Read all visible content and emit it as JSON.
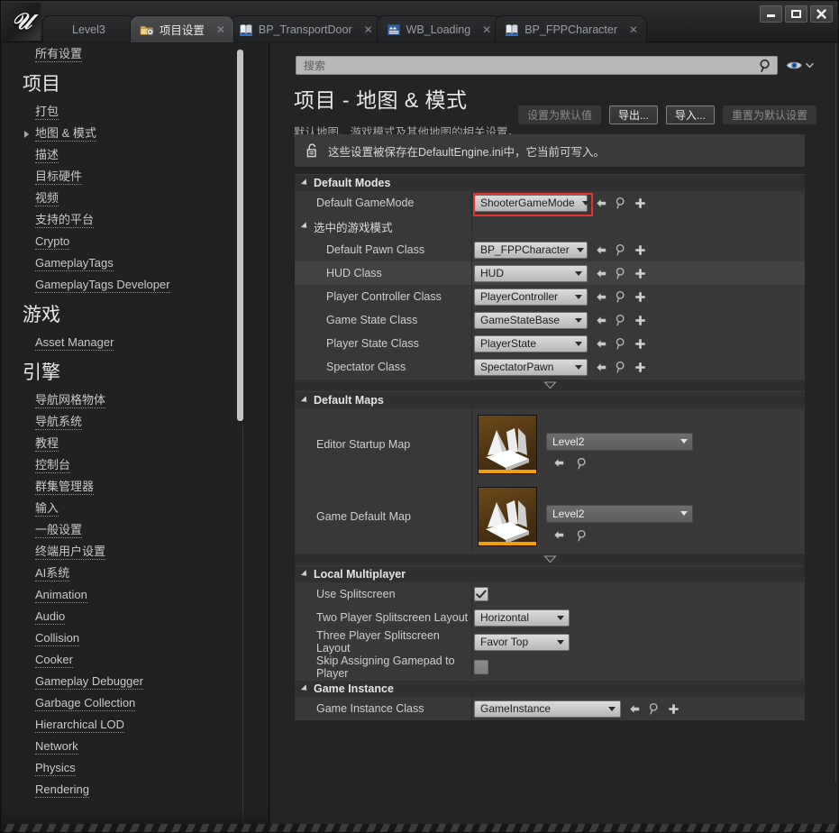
{
  "window": {
    "logo": "unreal-engine-logo",
    "controls": [
      {
        "name": "minimize",
        "glyph": "minimize-icon"
      },
      {
        "name": "maximize",
        "glyph": "maximize-icon"
      },
      {
        "name": "close",
        "glyph": "close-icon"
      }
    ]
  },
  "tabs": [
    {
      "label": "Level3",
      "icon": "level-icon",
      "active": false,
      "closable": false
    },
    {
      "label": "项目设置",
      "icon": "project-settings-icon",
      "active": true,
      "closable": true
    },
    {
      "label": "BP_TransportDoor",
      "icon": "blueprint-icon",
      "active": false,
      "closable": true
    },
    {
      "label": "WB_Loading",
      "icon": "widget-blueprint-icon",
      "active": false,
      "closable": true
    },
    {
      "label": "BP_FPPCharacter",
      "icon": "blueprint-icon",
      "active": false,
      "closable": true
    }
  ],
  "sidebar": {
    "all_settings": "所有设置",
    "sections": [
      {
        "heading": "项目",
        "items": [
          {
            "label": "打包",
            "expandable": false
          },
          {
            "label": "地图 & 模式",
            "expandable": true
          },
          {
            "label": "描述",
            "expandable": false
          },
          {
            "label": "目标硬件",
            "expandable": false
          },
          {
            "label": "视频",
            "expandable": false
          },
          {
            "label": "支持的平台",
            "expandable": false
          },
          {
            "label": "Crypto",
            "expandable": false
          },
          {
            "label": "GameplayTags",
            "expandable": false
          },
          {
            "label": "GameplayTags Developer",
            "expandable": false
          }
        ]
      },
      {
        "heading": "游戏",
        "items": [
          {
            "label": "Asset Manager",
            "expandable": false
          }
        ]
      },
      {
        "heading": "引擎",
        "items": [
          {
            "label": "导航网格物体",
            "expandable": false
          },
          {
            "label": "导航系统",
            "expandable": false
          },
          {
            "label": "教程",
            "expandable": false
          },
          {
            "label": "控制台",
            "expandable": false
          },
          {
            "label": "群集管理器",
            "expandable": false
          },
          {
            "label": "输入",
            "expandable": false
          },
          {
            "label": "一般设置",
            "expandable": false
          },
          {
            "label": "终端用户设置",
            "expandable": false
          },
          {
            "label": "AI系统",
            "expandable": false
          },
          {
            "label": "Animation",
            "expandable": false
          },
          {
            "label": "Audio",
            "expandable": false
          },
          {
            "label": "Collision",
            "expandable": false
          },
          {
            "label": "Cooker",
            "expandable": false
          },
          {
            "label": "Gameplay Debugger",
            "expandable": false
          },
          {
            "label": "Garbage Collection",
            "expandable": false
          },
          {
            "label": "Hierarchical LOD",
            "expandable": false
          },
          {
            "label": "Network",
            "expandable": false
          },
          {
            "label": "Physics",
            "expandable": false
          },
          {
            "label": "Rendering",
            "expandable": false
          }
        ]
      }
    ]
  },
  "search": {
    "placeholder": "搜索",
    "value": "",
    "magnifier_icon": "search-icon",
    "eye_icon": "visibility-eye-icon",
    "eye_dropdown_icon": "chevron-down-icon"
  },
  "header": {
    "title": "项目 - 地图 & 模式",
    "subtitle": "默认地图、游戏模式及其他地图的相关设置。",
    "buttons": [
      {
        "label": "设置为默认值",
        "enabled": false
      },
      {
        "label": "导出...",
        "enabled": true
      },
      {
        "label": "导入...",
        "enabled": true
      },
      {
        "label": "重置为默认设置",
        "enabled": false
      }
    ]
  },
  "info_bar": {
    "icon": "unlocked-padlock-icon",
    "text": "这些设置被保存在DefaultEngine.ini中，它当前可写入。"
  },
  "sections": [
    {
      "title": "Default Modes",
      "rows": [
        {
          "label": "Default GameMode",
          "type": "combo",
          "value": "ShooterGameMode",
          "width": "w126",
          "indent": 1,
          "highlighted": true,
          "actions": [
            "reset-arrow-icon",
            "browse-icon",
            "new-asset-icon"
          ]
        },
        {
          "label": "选中的游戏模式",
          "type": "subheader",
          "indent": 1
        },
        {
          "label": "Default Pawn Class",
          "type": "combo",
          "value": "BP_FPPCharacter",
          "width": "w126",
          "indent": 2,
          "actions": [
            "reset-arrow-icon",
            "browse-icon",
            "new-asset-icon"
          ]
        },
        {
          "label": "HUD Class",
          "type": "combo",
          "value": "HUD",
          "width": "w126",
          "indent": 2,
          "alt": true,
          "actions": [
            "reset-arrow-icon",
            "browse-icon",
            "new-asset-icon"
          ]
        },
        {
          "label": "Player Controller Class",
          "type": "combo",
          "value": "PlayerController",
          "width": "w126",
          "indent": 2,
          "actions": [
            "reset-arrow-icon",
            "browse-icon",
            "new-asset-icon"
          ]
        },
        {
          "label": "Game State Class",
          "type": "combo",
          "value": "GameStateBase",
          "width": "w126",
          "indent": 2,
          "actions": [
            "reset-arrow-icon",
            "browse-icon",
            "new-asset-icon"
          ]
        },
        {
          "label": "Player State Class",
          "type": "combo",
          "value": "PlayerState",
          "width": "w126",
          "indent": 2,
          "actions": [
            "reset-arrow-icon",
            "browse-icon",
            "new-asset-icon"
          ]
        },
        {
          "label": "Spectator Class",
          "type": "combo",
          "value": "SpectatorPawn",
          "width": "w126",
          "indent": 2,
          "actions": [
            "reset-arrow-icon",
            "browse-icon",
            "new-asset-icon"
          ]
        }
      ]
    },
    {
      "title": "Default Maps",
      "rows": [
        {
          "label": "Editor Startup Map",
          "type": "map",
          "value": "Level2",
          "thumbnail": "level-thumbnail",
          "actions": [
            "reset-arrow-icon",
            "browse-icon"
          ]
        },
        {
          "label": "Game Default Map",
          "type": "map",
          "value": "Level2",
          "thumbnail": "level-thumbnail",
          "actions": [
            "reset-arrow-icon",
            "browse-icon"
          ]
        }
      ]
    },
    {
      "title": "Local Multiplayer",
      "rows": [
        {
          "label": "Use Splitscreen",
          "type": "checkbox",
          "checked": true,
          "indent": 1
        },
        {
          "label": "Two Player Splitscreen Layout",
          "type": "combo",
          "value": "Horizontal",
          "width": "w106",
          "indent": 1
        },
        {
          "label": "Three Player Splitscreen Layout",
          "type": "combo",
          "value": "Favor Top",
          "width": "w106",
          "indent": 1
        },
        {
          "label": "Skip Assigning Gamepad to Player",
          "type": "checkbox",
          "checked": false,
          "indent": 1
        }
      ]
    },
    {
      "title": "Game Instance",
      "rows": [
        {
          "label": "Game Instance Class",
          "type": "combo",
          "value": "GameInstance",
          "width": "w163",
          "indent": 1,
          "actions": [
            "reset-arrow-icon",
            "browse-icon",
            "new-asset-icon"
          ]
        }
      ]
    }
  ],
  "colors": {
    "accent_red": "#e8302c",
    "thumbnail_bar": "#f1a208",
    "panel_bg": "#242424",
    "row_bg": "#383838",
    "row_alt_bg": "#424242"
  }
}
